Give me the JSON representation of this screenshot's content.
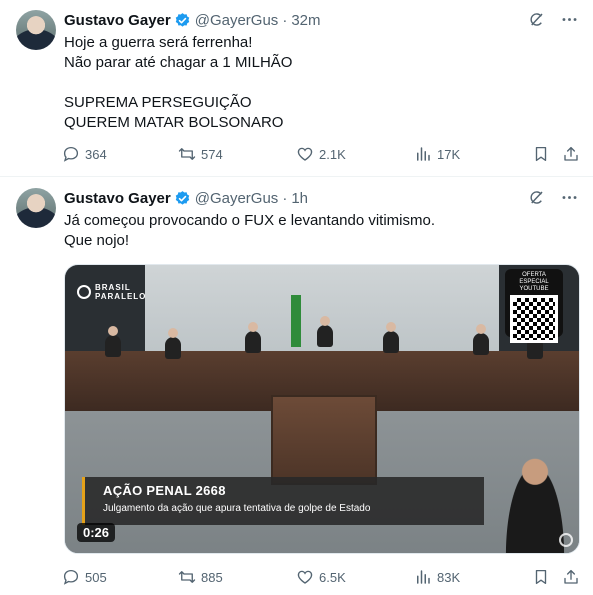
{
  "tweets": [
    {
      "author": {
        "name": "Gustavo Gayer",
        "handle": "@GayerGus",
        "time": "32m"
      },
      "separator": "·",
      "text_lines": [
        "Hoje a guerra será ferrenha!",
        "Não parar até chagar a 1 MILHÃO",
        "",
        "SUPREMA PERSEGUIÇÃO",
        "QUEREM MATAR BOLSONARO"
      ],
      "actions": {
        "replies": "364",
        "reposts": "574",
        "likes": "2.1K",
        "views": "17K"
      }
    },
    {
      "author": {
        "name": "Gustavo Gayer",
        "handle": "@GayerGus",
        "time": "1h"
      },
      "separator": "·",
      "text_lines": [
        "Já começou provocando o FUX e levantando vitimismo.",
        "Que nojo!"
      ],
      "media": {
        "logo_line1": "BRASIL",
        "logo_line2": "PARALELO",
        "qr_caption_line1": "OFERTA ESPECIAL",
        "qr_caption_line2": "YOUTUBE",
        "banner_title": "AÇÃO PENAL 2668",
        "banner_subtitle": "Julgamento da ação que apura tentativa de golpe de Estado",
        "duration": "0:26"
      },
      "actions": {
        "replies": "505",
        "reposts": "885",
        "likes": "6.5K",
        "views": "83K"
      }
    }
  ],
  "colors": {
    "text": "#0f1419",
    "secondary": "#536471",
    "verified": "#1d9bf0",
    "divider": "#eff3f4"
  },
  "icons": [
    "verified-badge-icon",
    "grok-icon",
    "more-icon",
    "reply-icon",
    "repost-icon",
    "like-icon",
    "views-icon",
    "bookmark-icon",
    "share-icon"
  ]
}
